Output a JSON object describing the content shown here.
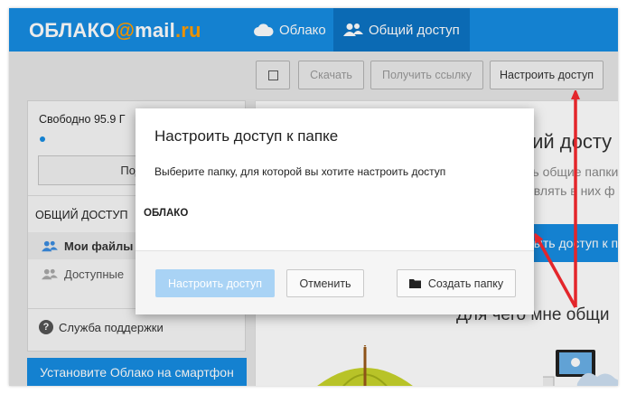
{
  "header": {
    "logo_main": "ОБЛАКО",
    "logo_at": "@",
    "logo_mail": "mail",
    "logo_dot": ".",
    "logo_ru": "ru",
    "tabs": [
      {
        "label": "Облако",
        "icon": "cloud-icon"
      },
      {
        "label": "Общий доступ",
        "icon": "users-icon",
        "active": true
      }
    ]
  },
  "toolbar": {
    "download_label": "Скачать",
    "getlink_label": "Получить ссылку",
    "setup_label": "Настроить доступ"
  },
  "sidebar": {
    "free_text": "Свободно 95.9 Г",
    "connect_label": "Подкл",
    "section_title": "ОБЩИЙ ДОСТУП",
    "items": [
      {
        "label": "Мои файлы",
        "icon": "users-icon"
      },
      {
        "label": "Доступные",
        "icon": "users-icon"
      }
    ],
    "support_label": "Служба поддержки"
  },
  "install_button_label": "Установите Облако на смартфон",
  "content": {
    "title": "щий досту",
    "subtitle_1": "ть общие папки",
    "subtitle_2": "авлять в них ф",
    "button_label": "рыть доступ к п",
    "why_text": "Для чего мне общи"
  },
  "modal": {
    "title": "Настроить доступ к папке",
    "description": "Выберите папку, для которой вы хотите настроить доступ",
    "folder_name": "ОБЛАКО",
    "setup_button_label": "Настроить доступ",
    "cancel_button_label": "Отменить",
    "create_folder_label": "Создать папку"
  },
  "colors": {
    "brand_blue": "#168de2",
    "active_tab": "#0d74c4",
    "logo_accent": "#ff9e00",
    "annotation_red": "#e3262b"
  }
}
